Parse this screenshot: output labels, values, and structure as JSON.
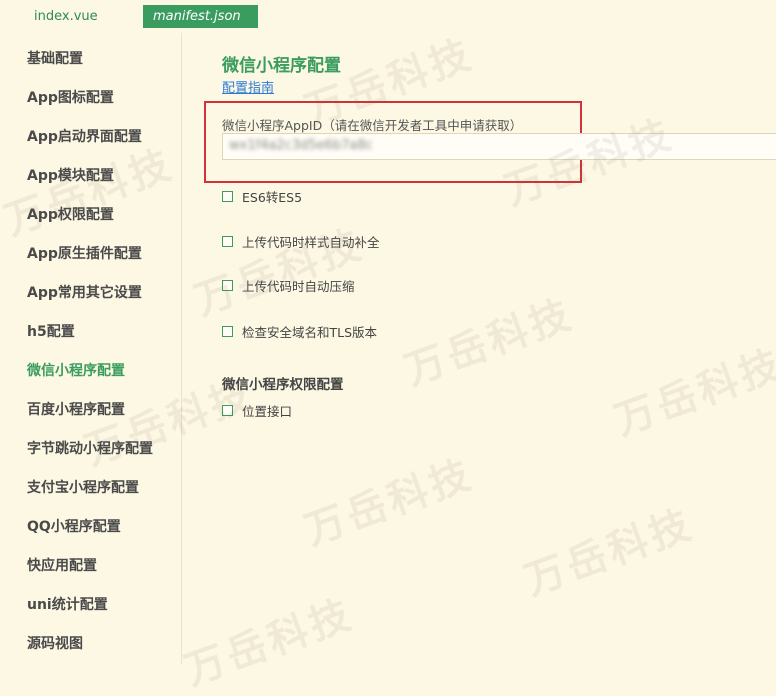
{
  "tabs": [
    {
      "label": "index.vue"
    },
    {
      "label": "manifest.json"
    }
  ],
  "sidebar": {
    "items": [
      {
        "label": "基础配置"
      },
      {
        "label": "App图标配置"
      },
      {
        "label": "App启动界面配置"
      },
      {
        "label": "App模块配置"
      },
      {
        "label": "App权限配置"
      },
      {
        "label": "App原生插件配置"
      },
      {
        "label": "App常用其它设置"
      },
      {
        "label": "h5配置"
      },
      {
        "label": "微信小程序配置"
      },
      {
        "label": "百度小程序配置"
      },
      {
        "label": "字节跳动小程序配置"
      },
      {
        "label": "支付宝小程序配置"
      },
      {
        "label": "QQ小程序配置"
      },
      {
        "label": "快应用配置"
      },
      {
        "label": "uni统计配置"
      },
      {
        "label": "源码视图"
      }
    ],
    "active_index": 8
  },
  "main": {
    "title": "微信小程序配置",
    "guide_link": "配置指南",
    "appid_label": "微信小程序AppID（请在微信开发者工具中申请获取）",
    "appid_value": "wx1f4a2c3d5e6b7a8c",
    "options": [
      {
        "label": "ES6转ES5",
        "checked": false
      },
      {
        "label": "上传代码时样式自动补全",
        "checked": false
      },
      {
        "label": "上传代码时自动压缩",
        "checked": false
      },
      {
        "label": "检查安全域名和TLS版本",
        "checked": false
      }
    ],
    "permissions_title": "微信小程序权限配置",
    "permission_options": [
      {
        "label": "位置接口",
        "checked": false
      }
    ]
  },
  "watermark_text": "万岳科技",
  "colors": {
    "accent": "#3a9c5f",
    "link": "#2a7bd6",
    "highlight": "#d0313a",
    "background": "#fdf8e4"
  }
}
